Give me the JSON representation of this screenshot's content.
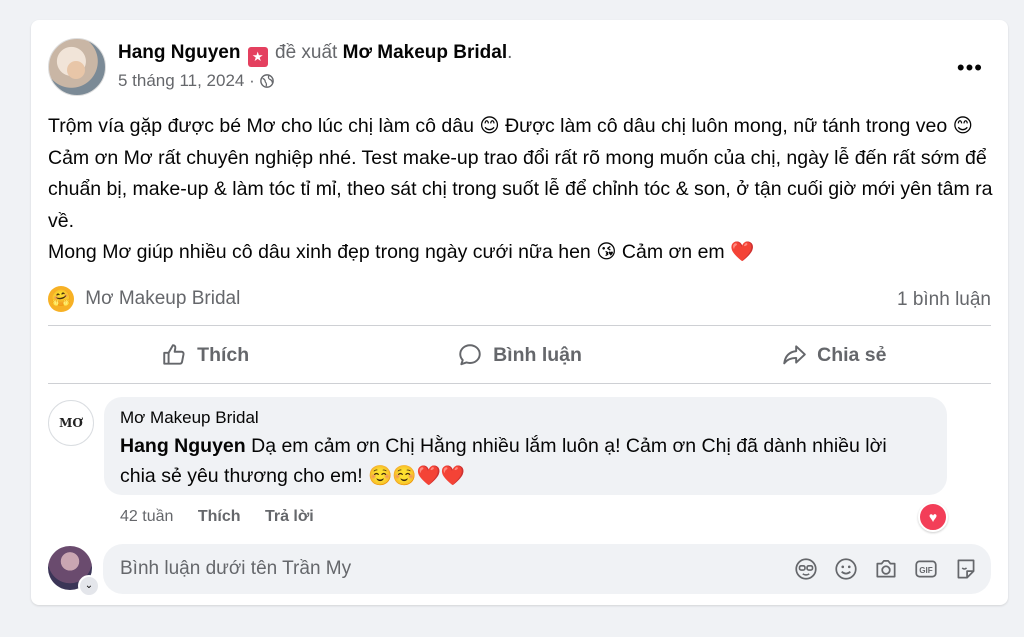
{
  "post": {
    "author": "Hang Nguyen",
    "verb": "đề xuất",
    "page": "Mơ Makeup Bridal",
    "period": ".",
    "date": "5 tháng 11, 2024",
    "separator": "·",
    "more": "•••",
    "lines": [
      "Trộm vía gặp được bé Mơ cho lúc chị làm cô dâu 😊 Được làm cô dâu chị luôn mong, nữ tánh trong veo 😊",
      "Cảm ơn Mơ rất chuyên nghiệp nhé. Test make-up trao đổi rất rõ mong muốn của chị, ngày lễ đến rất sớm để chuẩn bị, make-up & làm tóc tỉ mỉ, theo sát chị trong suốt lễ để chỉnh tóc & son, ở tận cuối giờ mới yên tâm ra về.",
      "Mong Mơ giúp nhiều cô dâu xinh đẹp trong ngày cưới nữa hen 😘 Cảm ơn em ❤️"
    ],
    "reaction_icon": "hug-emoji",
    "reactor": "Mơ Makeup Bridal",
    "comment_count": "1 bình luận"
  },
  "actions": {
    "like": "Thích",
    "comment": "Bình luận",
    "share": "Chia sẻ"
  },
  "comment": {
    "avatar_text": "MƠ",
    "name": "Mơ Makeup Bridal",
    "mention": "Hang Nguyen",
    "text": " Dạ em cảm ơn Chị Hằng nhiều lắm luôn ạ! Cảm ơn Chị đã dành nhiều lời chia sẻ yêu thương cho em! ☺️☺️❤️❤️",
    "time": "42 tuần",
    "like": "Thích",
    "reply": "Trả lời",
    "reaction_icon": "heart-icon"
  },
  "composer": {
    "placeholder": "Bình luận dưới tên Trần My",
    "icons": [
      "avatar-sticker-icon",
      "emoji-icon",
      "camera-icon",
      "gif-icon",
      "sticker-icon"
    ]
  },
  "colors": {
    "background": "#f0f2f5",
    "secondary_text": "#65676b",
    "heart": "#f33e58",
    "star_badge": "#e4405f"
  }
}
